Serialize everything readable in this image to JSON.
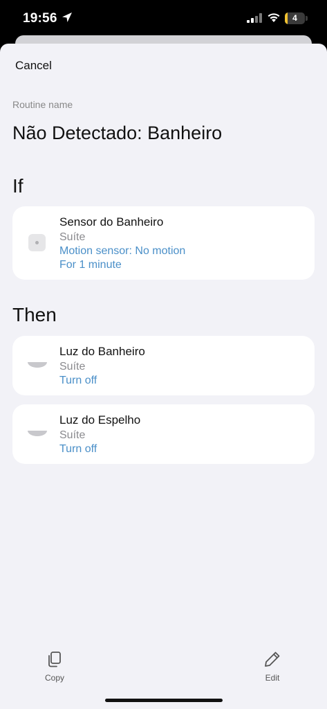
{
  "status_bar": {
    "time": "19:56",
    "battery_level": "4",
    "battery_fraction": 0.15
  },
  "header": {
    "cancel_label": "Cancel"
  },
  "routine": {
    "name_label": "Routine name",
    "name": "Não Detectado: Banheiro"
  },
  "if_section": {
    "title": "If",
    "items": [
      {
        "title": "Sensor do Banheiro",
        "room": "Suíte",
        "condition": "Motion sensor: No motion",
        "duration": "For 1 minute",
        "icon": "motion-sensor-icon"
      }
    ]
  },
  "then_section": {
    "title": "Then",
    "items": [
      {
        "title": "Luz do Banheiro",
        "room": "Suíte",
        "action": "Turn off",
        "icon": "ceiling-light-icon"
      },
      {
        "title": "Luz do Espelho",
        "room": "Suíte",
        "action": "Turn off",
        "icon": "ceiling-light-icon"
      }
    ]
  },
  "toolbar": {
    "copy_label": "Copy",
    "edit_label": "Edit"
  },
  "colors": {
    "accent": "#4a8fc8",
    "background": "#f2f2f7",
    "card": "#ffffff",
    "secondary_text": "#8a8a8e"
  }
}
